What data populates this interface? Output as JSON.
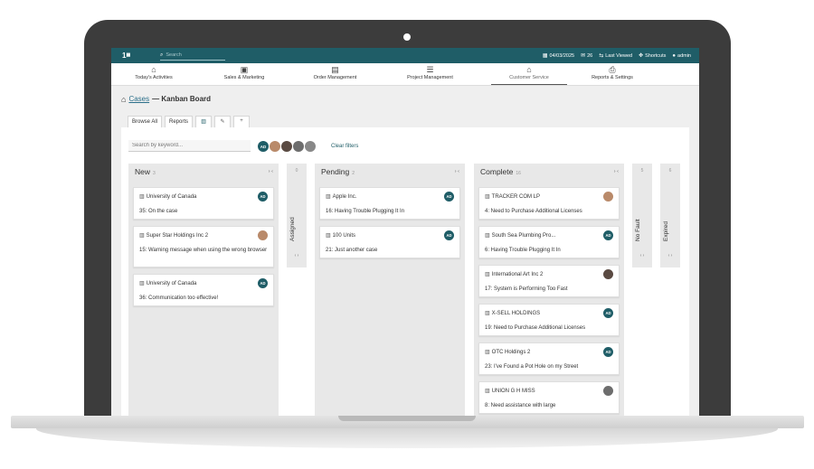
{
  "topbar": {
    "logo": "1",
    "search_placeholder": "Search",
    "date": "04/03/2025",
    "messages": "26",
    "last_viewed": "Last Viewed",
    "shortcuts": "Shortcuts",
    "user": "admin"
  },
  "nav": [
    {
      "label": "Today's Activities",
      "icon": "home-icon"
    },
    {
      "label": "Sales & Marketing",
      "icon": "briefcase-icon"
    },
    {
      "label": "Order Management",
      "icon": "clipboard-icon"
    },
    {
      "label": "Project Management",
      "icon": "tasks-icon"
    },
    {
      "label": "Customer Service",
      "icon": "inbox-icon",
      "active": true
    },
    {
      "label": "Reports & Settings",
      "icon": "printer-icon"
    }
  ],
  "breadcrumb": {
    "link": "Cases",
    "title": "— Kanban Board"
  },
  "tabs": {
    "browse": "Browse All",
    "reports": "Reports",
    "add": "+"
  },
  "filters": {
    "keyword_placeholder": "Search by keyword...",
    "avatar_ad": "AD",
    "clear": "Clear filters"
  },
  "columns": {
    "new": {
      "title": "New",
      "count": "3",
      "arrows": "› ‹",
      "cards": [
        {
          "company": "University of Canada",
          "case": "35: On the case",
          "avatar": "AD"
        },
        {
          "company": "Super Star Holdings Inc 2",
          "case": "15: Warning message when using the wrong browser",
          "avatar": ""
        },
        {
          "company": "University of Canada",
          "case": "36: Communication too effective!",
          "avatar": "AD"
        }
      ]
    },
    "assigned": {
      "title": "Assigned",
      "count": "0",
      "arrows": "‹ ›"
    },
    "pending": {
      "title": "Pending",
      "count": "2",
      "arrows": "› ‹",
      "cards": [
        {
          "company": "Apple Inc.",
          "case": "16: Having Trouble Plugging It In",
          "avatar": "AD"
        },
        {
          "company": "100 Units",
          "case": "21: Just another case",
          "avatar": "AD"
        }
      ]
    },
    "complete": {
      "title": "Complete",
      "count": "16",
      "arrows": "› ‹",
      "cards": [
        {
          "company": "TRACKER COM LP",
          "case": "4: Need to Purchase Additional Licenses",
          "avatar": ""
        },
        {
          "company": "South Sea Plumbing Pro...",
          "case": "6: Having Trouble Plugging It In",
          "avatar": "AD"
        },
        {
          "company": "International Art Inc 2",
          "case": "17: System is Performing Too Fast",
          "avatar": ""
        },
        {
          "company": "X-SELL HOLDINGS",
          "case": "19: Need to Purchase Additional Licenses",
          "avatar": "AD"
        },
        {
          "company": "OTC Holdings 2",
          "case": "23: I've Found a Pot Hole on my Street",
          "avatar": "AD"
        },
        {
          "company": "UNION G H MISS",
          "case": "8: Need assistance with large",
          "avatar": ""
        }
      ]
    },
    "nofault": {
      "title": "No Fault",
      "count": "5",
      "arrows": "‹ ›"
    },
    "expired": {
      "title": "Expired",
      "count": "6",
      "arrows": "‹ ›"
    }
  },
  "colors": {
    "brand": "#1f5d67",
    "column_bg": "#e8e8e8"
  }
}
